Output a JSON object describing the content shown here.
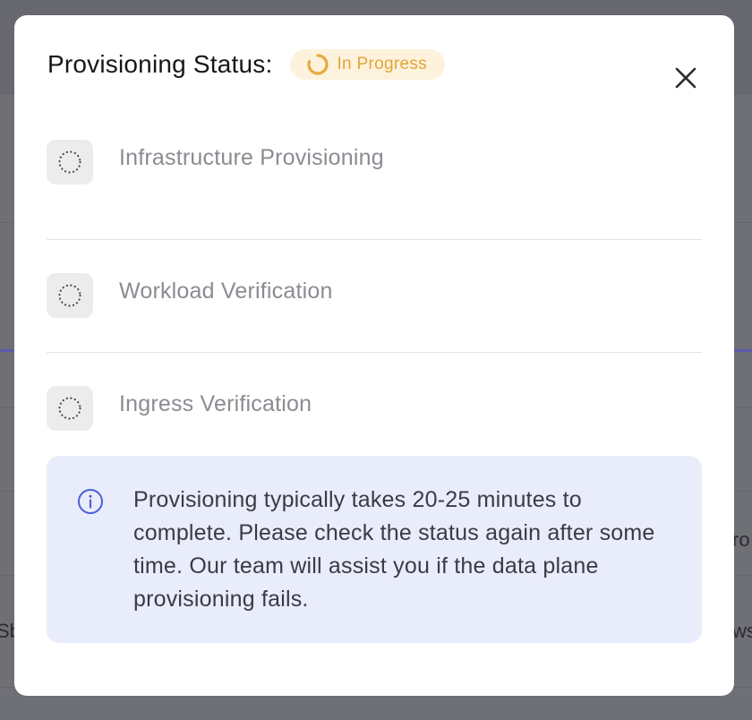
{
  "background": {
    "fragments": [
      "ro",
      "Sb",
      "ws"
    ]
  },
  "modal": {
    "title": "Provisioning Status:",
    "status_badge": {
      "label": "In Progress",
      "icon": "spinner-icon",
      "color": "#e3a43a",
      "background": "#fdf2dc"
    },
    "close_icon": "close-icon",
    "steps": [
      {
        "label": "Infrastructure Provisioning",
        "icon": "pending-dotted-circle-icon"
      },
      {
        "label": "Workload Verification",
        "icon": "pending-dotted-circle-icon"
      },
      {
        "label": "Ingress Verification",
        "icon": "pending-dotted-circle-icon"
      }
    ],
    "info": {
      "icon": "info-icon",
      "accent_color": "#4a5fd6",
      "text": "Provisioning typically takes 20-25 minutes to complete. Please check the status again after some time. Our team will assist you if the data plane provisioning fails."
    }
  }
}
